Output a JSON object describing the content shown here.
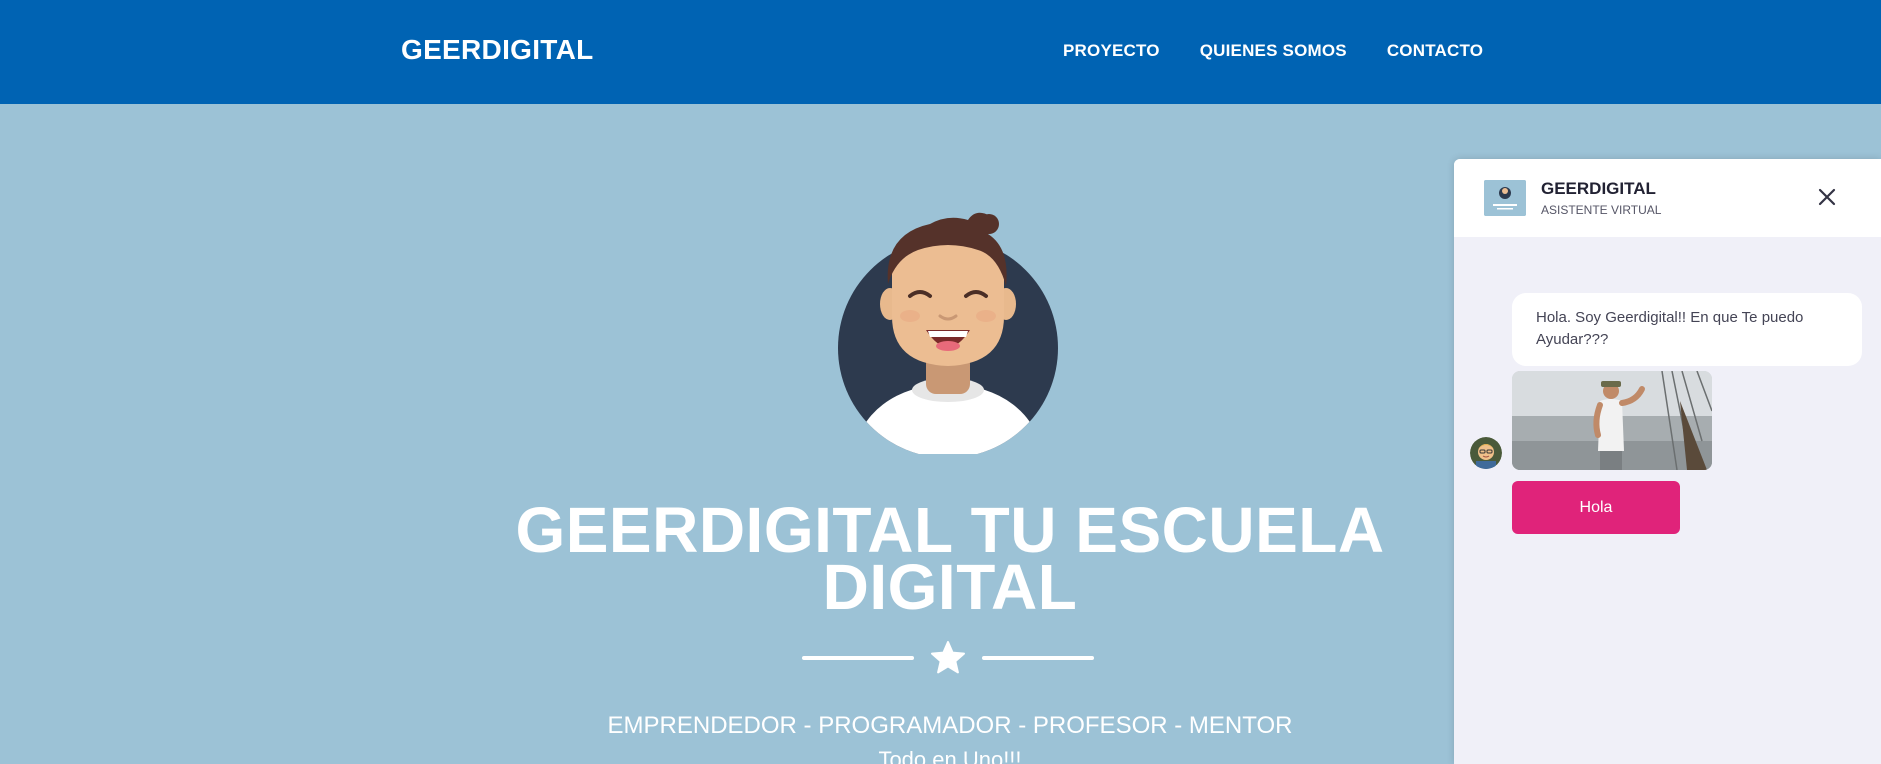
{
  "navbar": {
    "brand": "GEERDIGITAL",
    "links": [
      {
        "label": "PROYECTO"
      },
      {
        "label": "QUIENES SOMOS"
      },
      {
        "label": "CONTACTO"
      }
    ],
    "bg_color": "#0063b3"
  },
  "hero": {
    "title": "GEERDIGITAL  TU ESCUELA DIGITAL",
    "subtitle": "EMPRENDEDOR - PROGRAMADOR - PROFESOR - MENTOR",
    "tagline": "Todo en Uno!!!",
    "bg_color": "#9cc2d6",
    "divider_icon": "star-icon",
    "avatar_icon": "smiling-person-avatar"
  },
  "chat": {
    "name": "GEERDIGITAL",
    "role": "ASISTENTE VIRTUAL",
    "close_icon": "close-icon",
    "messages": [
      {
        "text": "Hola. Soy Geerdigital!! En que Te puedo Ayudar???"
      }
    ],
    "quick_reply": "Hola",
    "accent_color": "#e0237a"
  }
}
